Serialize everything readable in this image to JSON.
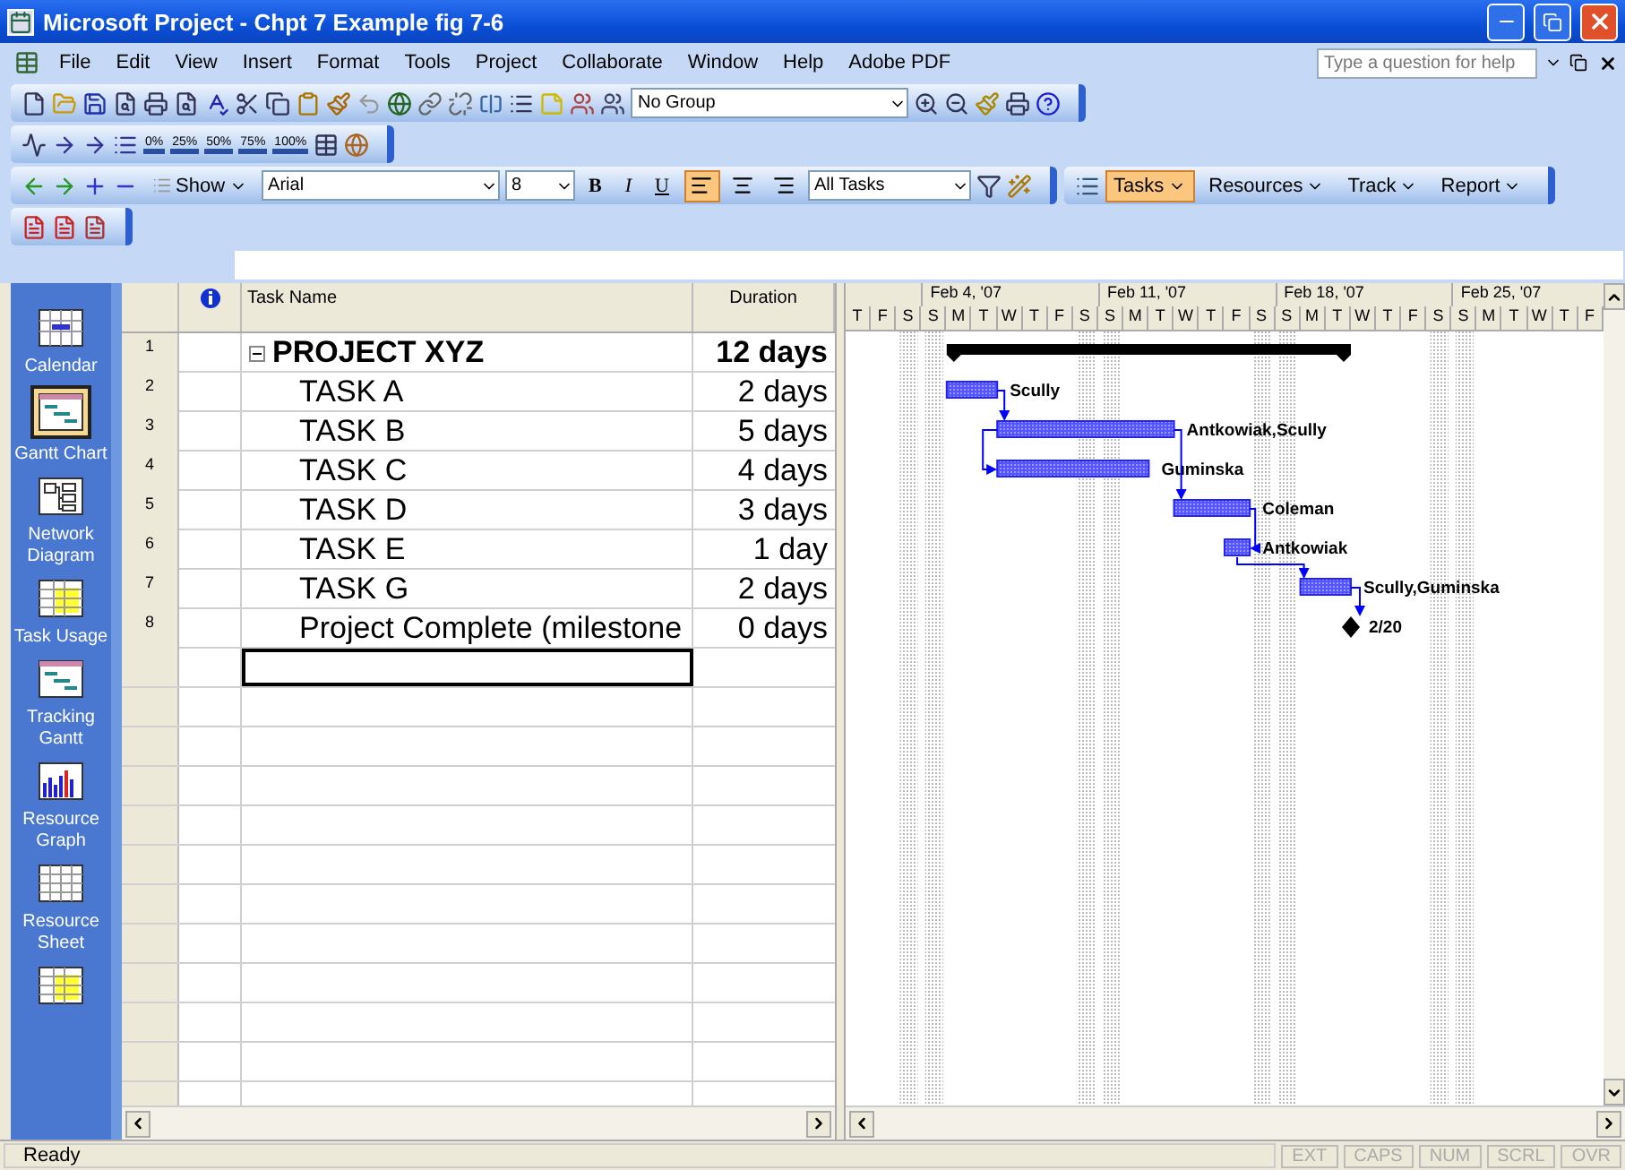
{
  "window": {
    "title": "Microsoft Project - Chpt 7 Example fig 7-6"
  },
  "menu": [
    "File",
    "Edit",
    "View",
    "Insert",
    "Format",
    "Tools",
    "Project",
    "Collaborate",
    "Window",
    "Help",
    "Adobe PDF"
  ],
  "help_box": {
    "placeholder": "Type a question for help"
  },
  "toolbar": {
    "group_select": "No Group",
    "percent_buttons": [
      "0%",
      "25%",
      "50%",
      "75%",
      "100%"
    ],
    "show_button": "Show",
    "font": "Arial",
    "font_size": "8",
    "bold": "B",
    "italic": "I",
    "underline": "U",
    "align": [
      {
        "selected": true
      },
      {
        "selected": false
      },
      {
        "selected": false
      }
    ],
    "filter": "All Tasks",
    "guide": [
      {
        "label": "Tasks",
        "selected": true
      },
      {
        "label": "Resources",
        "selected": false
      },
      {
        "label": "Track",
        "selected": false
      },
      {
        "label": "Report",
        "selected": false
      }
    ]
  },
  "views": [
    {
      "label": "Calendar",
      "kind": "calendar",
      "selected": false
    },
    {
      "label": "Gantt Chart",
      "kind": "gantt",
      "selected": true
    },
    {
      "label": "Network Diagram",
      "kind": "network",
      "selected": false
    },
    {
      "label": "Task Usage",
      "kind": "usage",
      "selected": false
    },
    {
      "label": "Tracking Gantt",
      "kind": "gantt",
      "selected": false
    },
    {
      "label": "Resource Graph",
      "kind": "graph",
      "selected": false
    },
    {
      "label": "Resource Sheet",
      "kind": "sheet",
      "selected": false
    },
    {
      "kind": "usage",
      "selected": false
    }
  ],
  "table": {
    "columns": [
      "Task Name",
      "Duration"
    ],
    "rows": [
      {
        "id": "1",
        "name": "PROJECT XYZ",
        "duration": "12 days",
        "kind": "summary",
        "expanded": true
      },
      {
        "id": "2",
        "name": "TASK A",
        "duration": "2 days",
        "kind": "task",
        "resources": "Scully"
      },
      {
        "id": "3",
        "name": "TASK B",
        "duration": "5 days",
        "kind": "task",
        "resources": "Antkowiak,Scully"
      },
      {
        "id": "4",
        "name": "TASK C",
        "duration": "4 days",
        "kind": "task",
        "resources": "Guminska"
      },
      {
        "id": "5",
        "name": "TASK D",
        "duration": "3 days",
        "kind": "task",
        "resources": "Coleman"
      },
      {
        "id": "6",
        "name": "TASK E",
        "duration": "1 day",
        "kind": "task",
        "resources": "Antkowiak"
      },
      {
        "id": "7",
        "name": "TASK G",
        "duration": "2 days",
        "kind": "task",
        "resources": "Scully,Guminska"
      },
      {
        "id": "8",
        "name": "Project Complete (milestone",
        "duration": "0 days",
        "kind": "milestone",
        "resources": "2/20"
      }
    ]
  },
  "timescale": {
    "weeks": [
      "Feb 4, '07",
      "Feb 11, '07",
      "Feb 18, '07",
      "Feb 25, '07"
    ],
    "days": [
      "T",
      "F",
      "S",
      "S",
      "M",
      "T",
      "W",
      "T",
      "F",
      "S",
      "S",
      "M",
      "T",
      "W",
      "T",
      "F",
      "S",
      "S",
      "M",
      "T",
      "W",
      "T",
      "F",
      "S",
      "S",
      "M",
      "T",
      "W",
      "T",
      "F"
    ]
  },
  "status_bar": {
    "text": "Ready",
    "indicators": [
      {
        "label": "EXT",
        "on": false
      },
      {
        "label": "CAPS",
        "on": false
      },
      {
        "label": "NUM",
        "on": false
      },
      {
        "label": "SCRL",
        "on": false
      },
      {
        "label": "OVR",
        "on": false
      }
    ]
  }
}
